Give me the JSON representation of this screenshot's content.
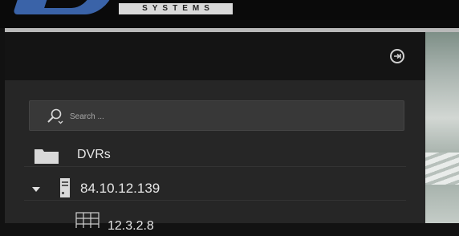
{
  "header": {
    "brand": "SYSTEMS"
  },
  "panel": {
    "pin_icon": "pin-icon",
    "search": {
      "placeholder": "Search ...",
      "value": "",
      "icon": "search-icon"
    },
    "tree": [
      {
        "label": "DVRs",
        "icon": "folder-icon"
      },
      {
        "label": "84.10.12.139",
        "icon": "server-icon",
        "expanded": true
      },
      {
        "label": "12.3.2.8",
        "icon": "camera-grid-icon"
      }
    ]
  }
}
